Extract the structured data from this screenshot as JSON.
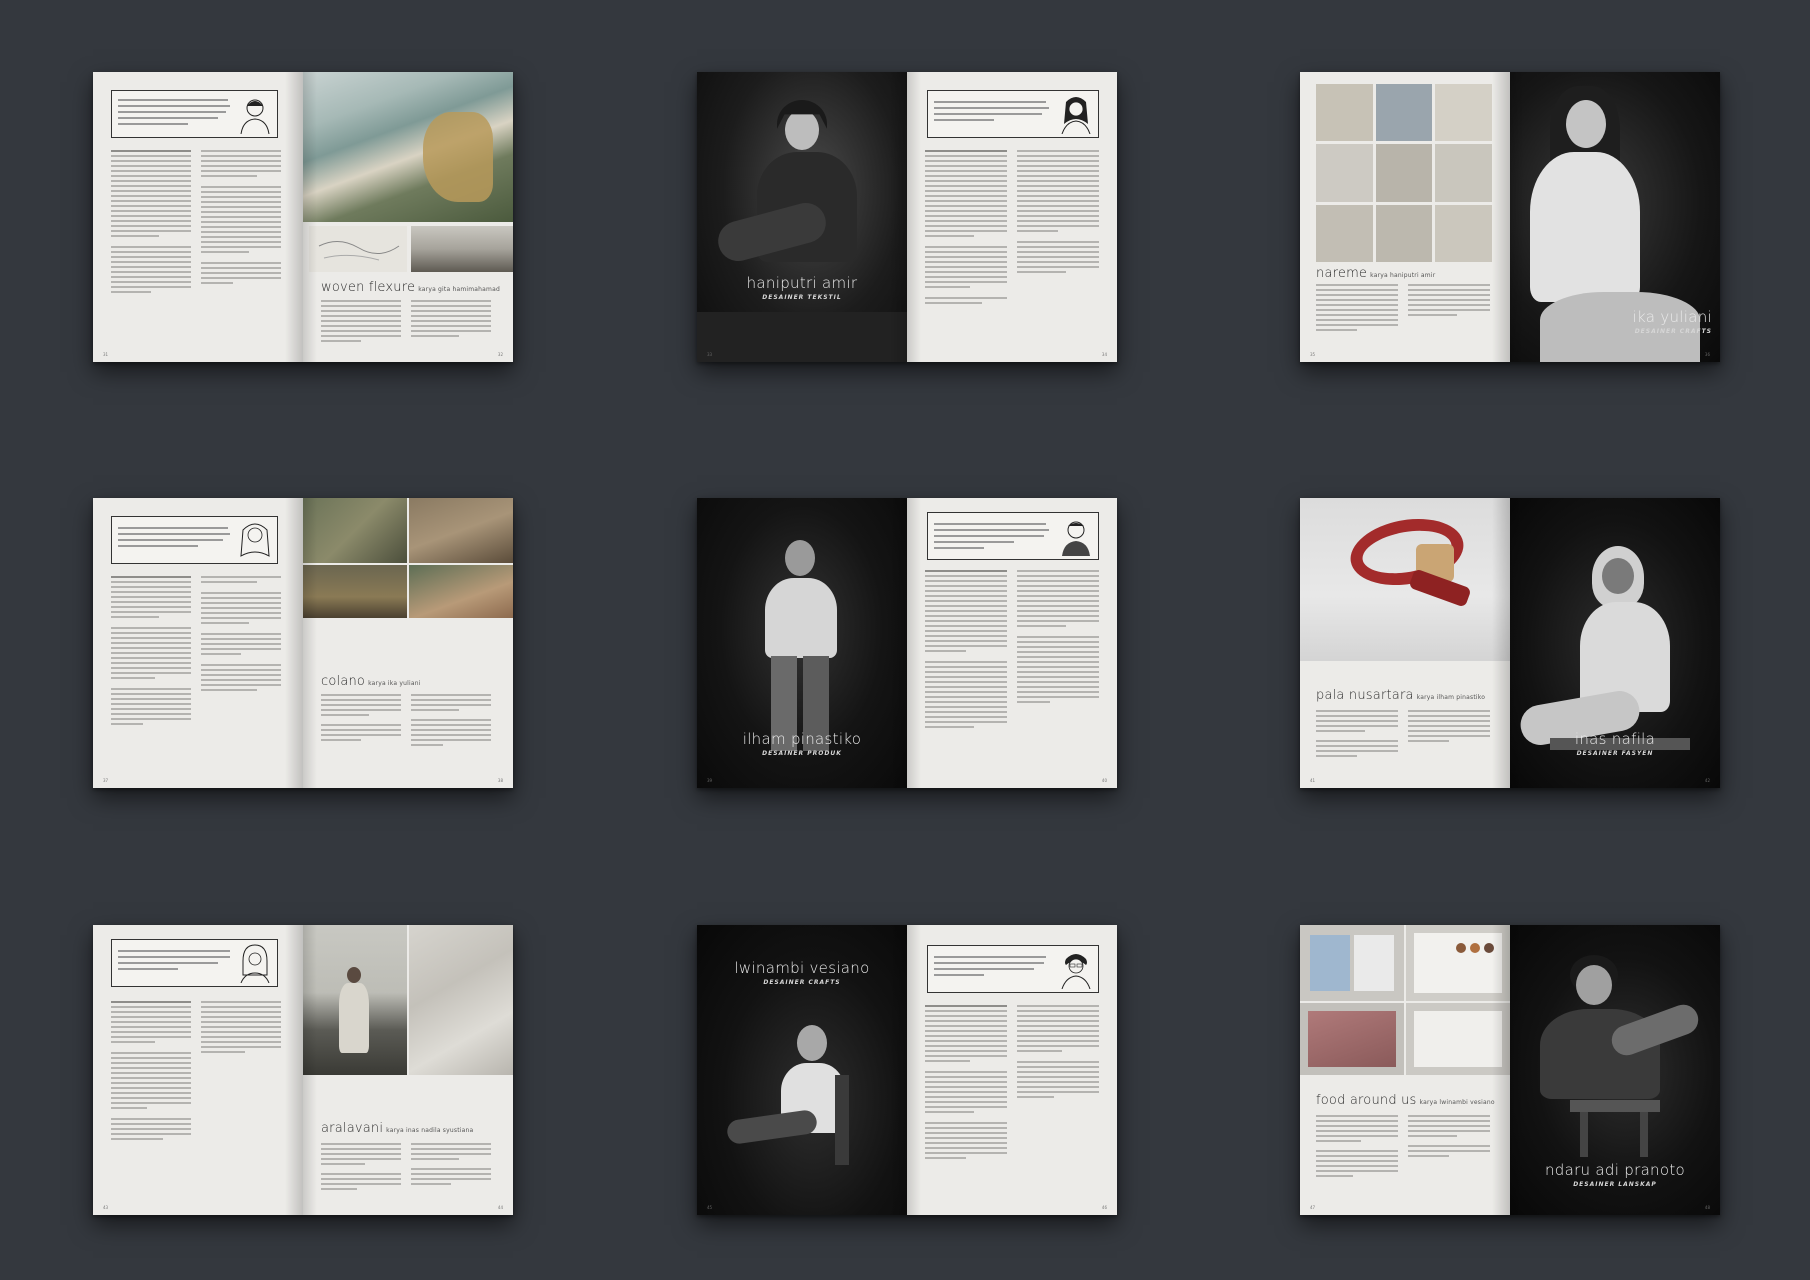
{
  "spreads": [
    {
      "id": "woven-flexure",
      "title": "woven flexure",
      "subtitle": "karya gita hamimahamad",
      "quote": "Yang membuat saya tetap menginginkan berkelanjutan ini adalah yang pemandangan yang saya nikmati di desa. Bukan hanya sekedar gaji, pekerjaan ini membuat saya hidup dan mengisi waktu.",
      "page_left": "31",
      "page_right": "32"
    },
    {
      "id": "haniputri-amir",
      "name": "haniputri amir",
      "role": "DESAINER TEKSTIL",
      "page_left": "33",
      "page_right": "34"
    },
    {
      "id": "nareme",
      "title": "nareme",
      "subtitle": "karya haniputri amir",
      "name": "ika yuliani",
      "role": "DESAINER CRAFTS",
      "page_left": "35",
      "page_right": "36"
    },
    {
      "id": "colano",
      "title": "colano",
      "subtitle": "karya ika yuliani",
      "page_left": "37",
      "page_right": "38"
    },
    {
      "id": "ilham-pinastiko",
      "name": "ilham pinastiko",
      "role": "DESAINER PRODUK",
      "page_left": "39",
      "page_right": "40"
    },
    {
      "id": "pala-nusantara",
      "title": "pala nusartara",
      "subtitle": "karya ilham pinastiko",
      "name": "inas nafila",
      "role": "DESAINER FASYEN",
      "page_left": "41",
      "page_right": "42"
    },
    {
      "id": "aralavani",
      "title": "aralavani",
      "subtitle": "karya inas nadila syustiana",
      "page_left": "43",
      "page_right": "44"
    },
    {
      "id": "lwinambi-vesiano",
      "name": "lwinambi vesiano",
      "role": "DESAINER CRAFTS",
      "page_left": "45",
      "page_right": "46"
    },
    {
      "id": "food-around-us",
      "title": "food around us",
      "subtitle": "karya lwinambi vesiano",
      "name": "ndaru adi pranoto",
      "role": "DESAINER LANSKAP",
      "page_left": "47",
      "page_right": "48"
    }
  ]
}
